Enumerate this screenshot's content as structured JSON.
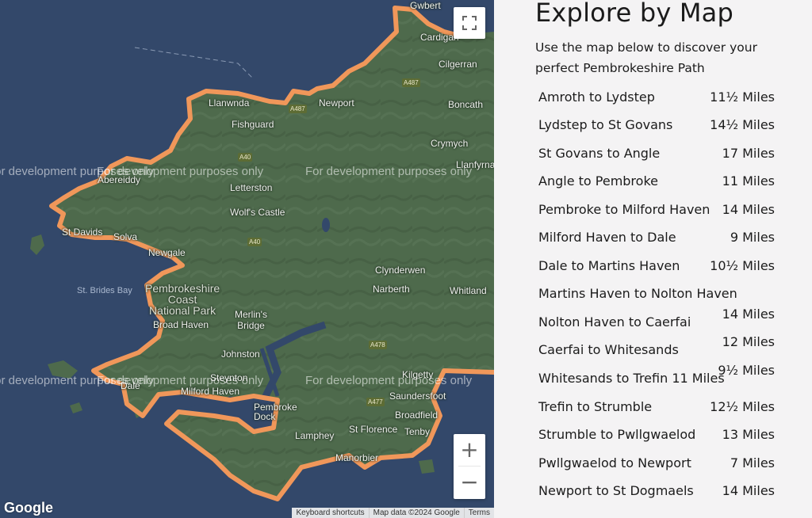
{
  "map": {
    "places": [
      {
        "name": "Gwbert",
        "id": "gwbert"
      },
      {
        "name": "Cardigan",
        "id": "cardigan"
      },
      {
        "name": "Cilgerran",
        "id": "cilgerran"
      },
      {
        "name": "Llanwnda",
        "id": "llanwnda"
      },
      {
        "name": "Newport",
        "id": "newport"
      },
      {
        "name": "Boncath",
        "id": "boncath"
      },
      {
        "name": "Fishguard",
        "id": "fishguard"
      },
      {
        "name": "Crymych",
        "id": "crymych"
      },
      {
        "name": "Llanfyrnach",
        "id": "llanfyrnach"
      },
      {
        "name": "Abereiddy",
        "id": "abereiddy"
      },
      {
        "name": "Letterston",
        "id": "letterston"
      },
      {
        "name": "Wolf's Castle",
        "id": "wolfs-castle"
      },
      {
        "name": "St Davids",
        "id": "st-davids"
      },
      {
        "name": "Solva",
        "id": "solva"
      },
      {
        "name": "Newgale",
        "id": "newgale"
      },
      {
        "name": "Clynderwen",
        "id": "clynderwen"
      },
      {
        "name": "St. Brides Bay",
        "id": "st-brides-bay"
      },
      {
        "name": "Pembrokeshire\nCoast\nNational Park",
        "id": "national-park"
      },
      {
        "name": "Broad Haven",
        "id": "broad-haven"
      },
      {
        "name": "Merlin's\nBridge",
        "id": "merlins-bridge"
      },
      {
        "name": "Narberth",
        "id": "narberth"
      },
      {
        "name": "Whitland",
        "id": "whitland"
      },
      {
        "name": "Johnston",
        "id": "johnston"
      },
      {
        "name": "Steynton",
        "id": "steynton"
      },
      {
        "name": "Milford Haven",
        "id": "milford-haven"
      },
      {
        "name": "Dale",
        "id": "dale"
      },
      {
        "name": "Pembroke\nDock",
        "id": "pembroke-dock"
      },
      {
        "name": "Kilgetty",
        "id": "kilgetty"
      },
      {
        "name": "Saundersfoot",
        "id": "saundersfoot"
      },
      {
        "name": "Broadfield",
        "id": "broadfield"
      },
      {
        "name": "Tenby",
        "id": "tenby"
      },
      {
        "name": "St Florence",
        "id": "st-florence"
      },
      {
        "name": "Lamphey",
        "id": "lamphey"
      },
      {
        "name": "Manorbier",
        "id": "manorbier"
      }
    ],
    "roads": [
      "A487",
      "A487",
      "A40",
      "A40",
      "A477",
      "A478"
    ],
    "watermark": "For development purposes only",
    "google_logo": "Google",
    "attribution": {
      "shortcuts": "Keyboard shortcuts",
      "data": "Map data ©2024 Google",
      "terms": "Terms"
    },
    "zoom_in": "+",
    "zoom_out": "−",
    "route_color": "#f0975a",
    "land_color": "#4e6a4c",
    "sea_color": "#33486a"
  },
  "panel": {
    "title": "Explore by Map",
    "intro": "Use the map below to discover your perfect Pembrokeshire Path",
    "routes": [
      {
        "name": "Amroth to Lydstep",
        "miles": "11½ Miles"
      },
      {
        "name": "Lydstep to St Govans",
        "miles": "14½ Miles"
      },
      {
        "name": "St Govans to Angle",
        "miles": "17 Miles"
      },
      {
        "name": "Angle to Pembroke",
        "miles": "11 Miles"
      },
      {
        "name": "Pembroke to Milford Haven",
        "miles": "14 Miles"
      },
      {
        "name": "Milford Haven to Dale",
        "miles": "9 Miles"
      },
      {
        "name": "Dale to Martins Haven",
        "miles": "10½ Miles"
      },
      {
        "name": "Martins Haven to Nolton Haven",
        "miles": ""
      },
      {
        "name": "Nolton Haven to Caerfai",
        "miles": "14 Miles"
      },
      {
        "name": "Caerfai to Whitesands",
        "miles": "12 Miles"
      },
      {
        "name": "Whitesands to Trefin  11 Miles",
        "miles": "9½ Miles"
      },
      {
        "name": "Trefin to Strumble",
        "miles": "12½ Miles"
      },
      {
        "name": "Strumble to Pwllgwaelod",
        "miles": "13 Miles"
      },
      {
        "name": "Pwllgwaelod to Newport",
        "miles": "7 Miles"
      },
      {
        "name": "Newport to St Dogmaels",
        "miles": "14 Miles"
      }
    ]
  }
}
